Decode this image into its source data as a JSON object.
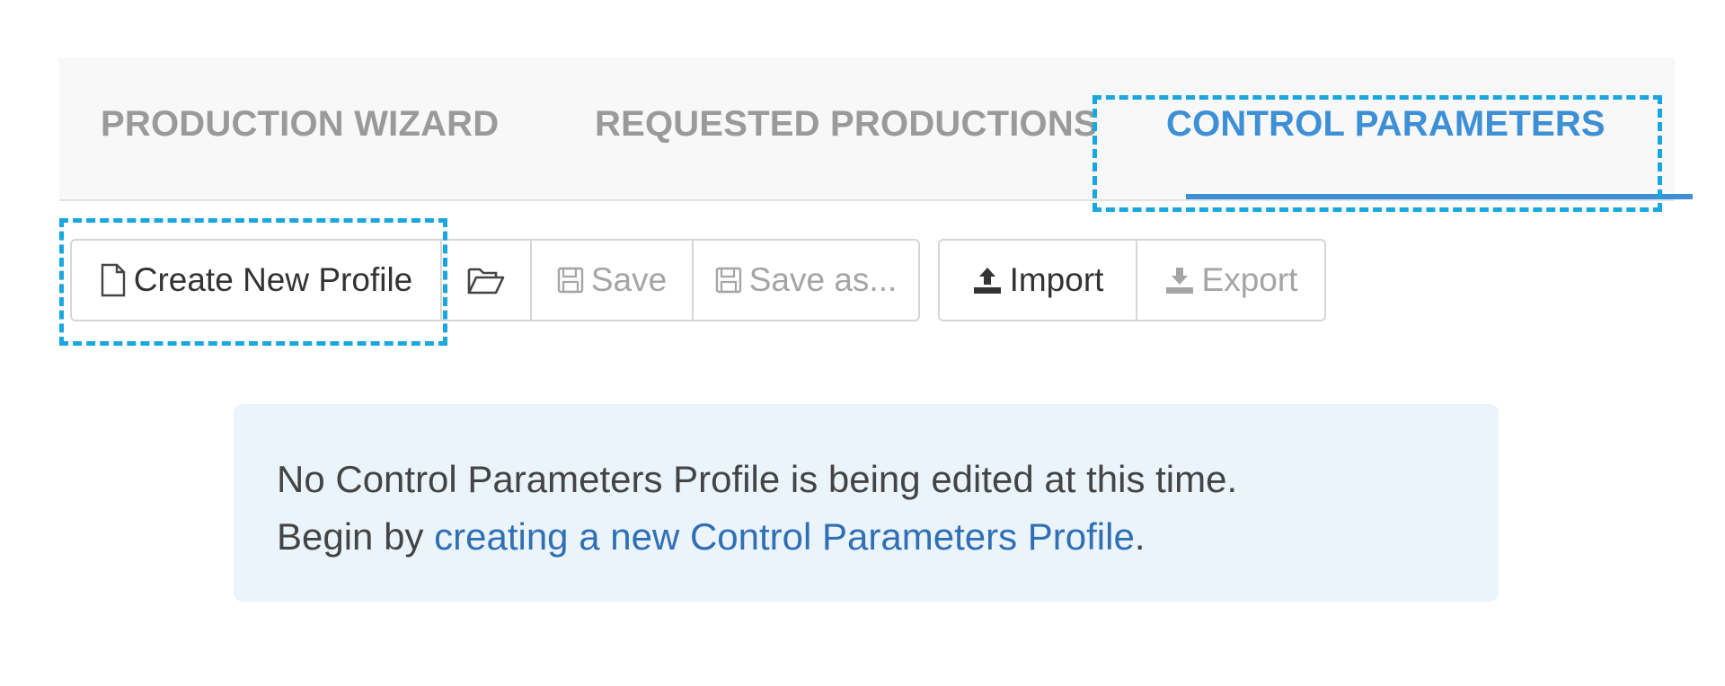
{
  "tabs": [
    {
      "label": "PRODUCTION WIZARD",
      "active": false
    },
    {
      "label": "REQUESTED PRODUCTIONS",
      "active": false
    },
    {
      "label": "CONTROL PARAMETERS",
      "active": true
    }
  ],
  "toolbar": {
    "create_label": "Create New Profile",
    "save_label": "Save",
    "save_as_label": "Save as...",
    "import_label": "Import",
    "export_label": "Export"
  },
  "icons": {
    "create": "file-icon",
    "open": "folder-open-icon",
    "save": "floppy-disk-icon",
    "save_as": "floppy-disk-icon",
    "import": "upload-icon",
    "export": "download-icon"
  },
  "alert": {
    "line1": "No Control Parameters Profile is being edited at this time.",
    "line2_prefix": "Begin by ",
    "line2_link": "creating a new Control Parameters Profile",
    "line2_suffix": "."
  },
  "colors": {
    "accent": "#3d8fd6",
    "highlight": "#1aa7e0",
    "alert_bg": "#ebf3fb",
    "link": "#2f6fb4"
  }
}
